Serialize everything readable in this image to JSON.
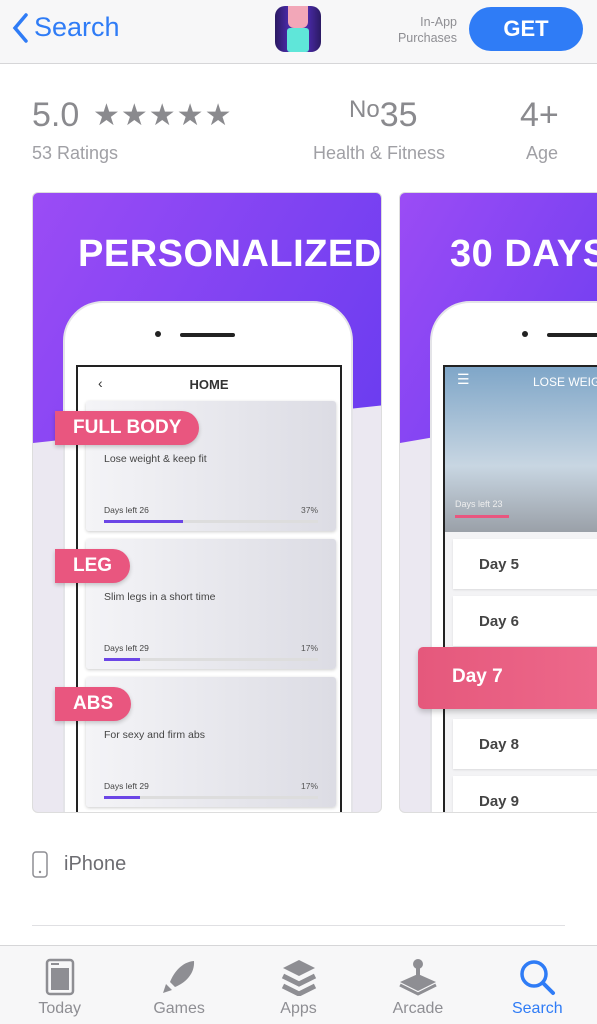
{
  "header": {
    "back_label": "Search",
    "in_app": "In-App Purchases",
    "get_label": "GET"
  },
  "stats": {
    "rating": "5.0",
    "stars": "★★★★★",
    "star_value": 5,
    "ratings_count": "53 Ratings",
    "rank_prefix": "No",
    "rank": "35",
    "category": "Health & Fitness",
    "age": "4+",
    "age_label": "Age"
  },
  "screenshots": [
    {
      "title": "PERSONALIZED",
      "screen_title": "HOME",
      "cards": [
        {
          "tag": "FULL BODY",
          "desc": "Lose weight & keep fit",
          "days": "Days left 26",
          "pct": "37%",
          "progress": 0.37
        },
        {
          "tag": "LEG",
          "desc": "Slim legs in a short time",
          "days": "Days left 29",
          "pct": "17%",
          "progress": 0.17
        },
        {
          "tag": "ABS",
          "desc": "For sexy and firm abs",
          "days": "Days left 29",
          "pct": "17%",
          "progress": 0.17
        }
      ]
    },
    {
      "title": "30 DAYS",
      "screen_title": "LOSE WEIGHT",
      "days_left": "Days left 23",
      "days": [
        "Day  5",
        "Day  6",
        "Day 7",
        "Day  8",
        "Day  9"
      ]
    }
  ],
  "device": "iPhone",
  "tabs": [
    {
      "label": "Today"
    },
    {
      "label": "Games"
    },
    {
      "label": "Apps"
    },
    {
      "label": "Arcade"
    },
    {
      "label": "Search",
      "active": true
    }
  ],
  "colors": {
    "accent": "#2f7cf6",
    "tag": "#e9567f",
    "purple": "#7a3ff2"
  }
}
